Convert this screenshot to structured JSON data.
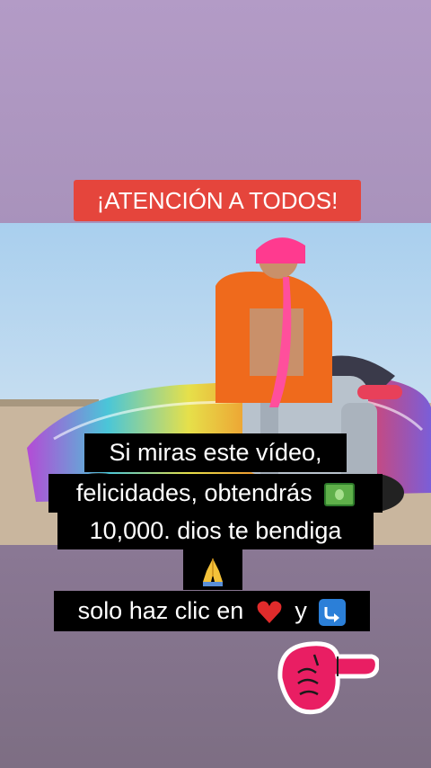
{
  "story": {
    "banner_text": "¡ATENCIÓN A TODOS!",
    "caption": {
      "line1": "Si miras este vídeo,",
      "line2": "felicidades, obtendrás",
      "line3": "10,000. dios te bendiga",
      "line5_prefix": "solo haz clic en",
      "line5_middle": "y"
    },
    "icons": {
      "cash": "dollar-banknote-icon",
      "pray": "folded-hands-icon",
      "heart": "red-heart-icon",
      "share": "share-arrow-icon",
      "pointer": "pointing-hand-sticker"
    },
    "colors": {
      "banner_bg": "#e5453c",
      "caption_bg": "#000000",
      "sticker_pink": "#e91e63"
    }
  }
}
